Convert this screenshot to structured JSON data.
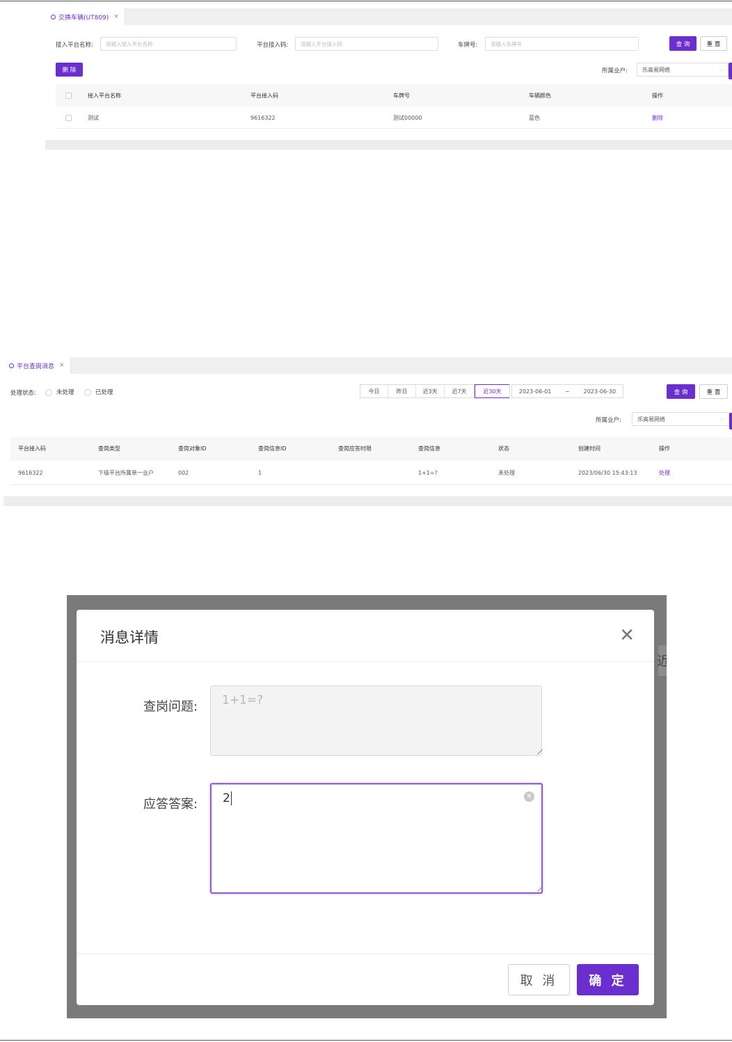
{
  "screen1": {
    "tab": {
      "label": "交换车辆(UT809)",
      "close": "×"
    },
    "filters": {
      "platform_name": {
        "label": "接入平台名称:",
        "placeholder": "请输入接入平台名称"
      },
      "access_code": {
        "label": "平台接入码:",
        "placeholder": "请输入平台接入码"
      },
      "plate": {
        "label": "车牌号:",
        "placeholder": "请输入车牌号"
      },
      "query": "查 询",
      "reset": "重 置"
    },
    "delete_button": "删 除",
    "owner": {
      "label": "所属业户:",
      "value": "乐高易网络"
    },
    "table": {
      "columns": [
        "接入平台名称",
        "平台接入码",
        "车牌号",
        "车辆颜色",
        "操作"
      ],
      "rows": [
        {
          "name": "测试",
          "code": "9616322",
          "plate": "测试00000",
          "color": "蓝色",
          "action": "删除"
        }
      ]
    }
  },
  "screen2": {
    "tab": {
      "label": "平台查岗消息",
      "close": "×"
    },
    "status": {
      "label": "处理状态:",
      "options": [
        "未处理",
        "已处理"
      ]
    },
    "ranges": [
      "今日",
      "昨日",
      "近3天",
      "近7天",
      "近30天"
    ],
    "active_range": "近30天",
    "date_from": "2023-06-01",
    "date_sep": "~",
    "date_to": "2023-06-30",
    "query": "查 询",
    "reset": "重 置",
    "owner": {
      "label": "所属业户:",
      "value": "乐高易网络"
    },
    "table": {
      "columns": [
        "平台接入码",
        "查岗类型",
        "查岗对象ID",
        "查岗信息ID",
        "查岗应答时限",
        "查岗信息",
        "状态",
        "创建时间",
        "操作"
      ],
      "rows": [
        {
          "code": "9616322",
          "type": "下级平台所属单一业户",
          "object_id": "002",
          "info_id": "1",
          "limit": "",
          "info": "1+1=?",
          "status": "未处理",
          "created": "2023/06/30 15:43:13",
          "action": "处理"
        }
      ]
    }
  },
  "dialog": {
    "title": "消息详情",
    "question_label": "查岗问题:",
    "question_value": "1+1=?",
    "answer_label": "应答答案:",
    "answer_value": "2",
    "cancel": "取 消",
    "confirm": "确 定",
    "background_glyph": "近"
  }
}
